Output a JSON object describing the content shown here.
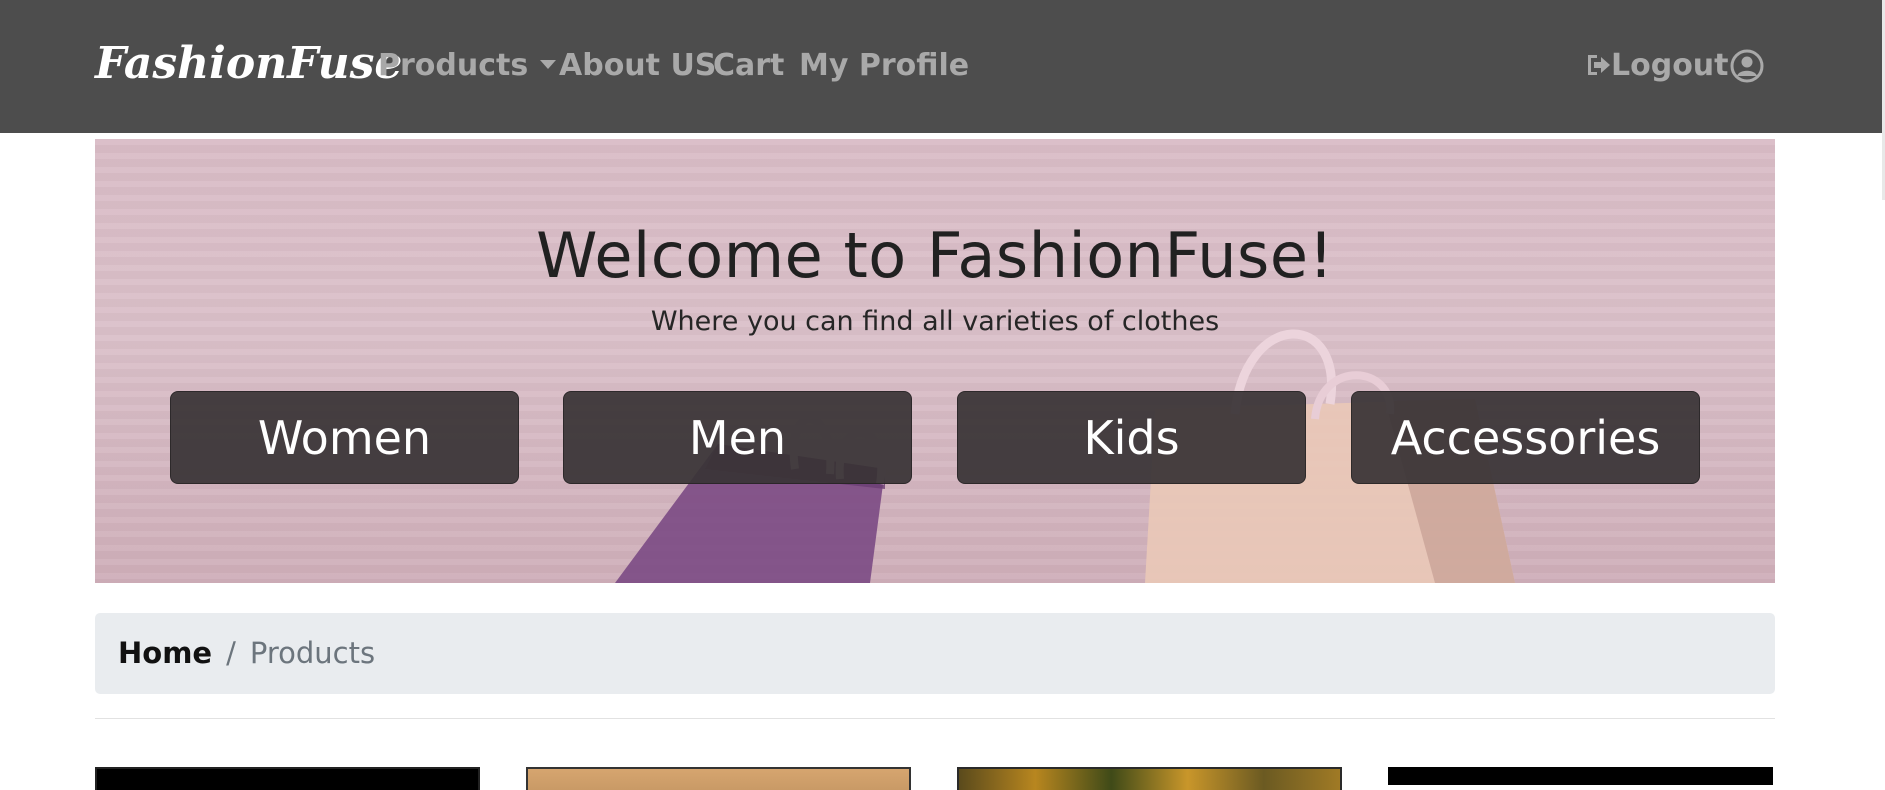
{
  "navbar": {
    "brand": "FashionFuse",
    "links": {
      "products": "Products",
      "about": "About US",
      "cart": "Cart",
      "profile": "My Profile",
      "logout": "Logout"
    },
    "icons": {
      "products_dropdown": "caret-down-icon",
      "logout": "sign-out-icon",
      "profile": "user-circle-icon"
    },
    "colors": {
      "background": "#4d4d4d",
      "link": "#a9a9a9",
      "brand": "#ffffff"
    }
  },
  "hero": {
    "title": "Welcome to FashionFuse!",
    "subtitle": "Where you can find all varieties of clothes",
    "categories": [
      "Women",
      "Men",
      "Kids",
      "Accessories"
    ]
  },
  "breadcrumb": {
    "home": "Home",
    "separator": "/",
    "current": "Products"
  }
}
